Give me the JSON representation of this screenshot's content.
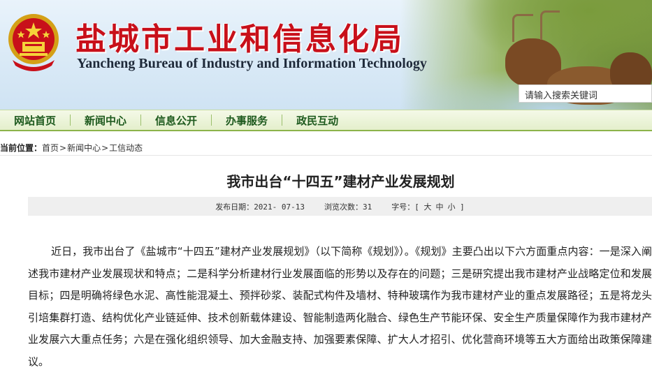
{
  "header": {
    "title_cn": "盐城市工业和信息化局",
    "title_en": "Yancheng Bureau of Industry and Information Technology",
    "search_placeholder": "请输入搜索关键词",
    "emblem_icon": "national-emblem-icon"
  },
  "nav": {
    "items": [
      {
        "label": "网站首页"
      },
      {
        "label": "新闻中心"
      },
      {
        "label": "信息公开"
      },
      {
        "label": "办事服务"
      },
      {
        "label": "政民互动"
      }
    ]
  },
  "breadcrumb": {
    "label": "当前位置：",
    "items": [
      "首页",
      "新闻中心",
      "工信动态"
    ],
    "separator": ">"
  },
  "article": {
    "title": "我市出台“十四五”建材产业发展规划",
    "publish_label": "发布日期：",
    "publish_date": "2021- 07-13",
    "views_label": "浏览次数：",
    "views": "31",
    "font_label": "字号：",
    "font_open": "[",
    "font_large": "大",
    "font_medium": "中",
    "font_small": "小",
    "font_close": "]",
    "body": "近日，我市出台了《盐城市“十四五”建材产业发展规划》（以下简称《规划》）。《规划》主要凸出以下六方面重点内容：一是深入阐述我市建材产业发展现状和特点；二是科学分析建材行业发展面临的形势以及存在的问题；三是研究提出我市建材产业战略定位和发展目标；四是明确将绿色水泥、高性能混凝土、预拌砂浆、装配式构件及墙材、特种玻璃作为我市建材产业的重点发展路径；五是将龙头引培集群打造、结构优化产业链延伸、技术创新载体建设、智能制造两化融合、绿色生产节能环保、安全生产质量保障作为我市建材产业发展六大重点任务；六是在强化组织领导、加大金融支持、加强要素保障、扩大人才招引、优化营商环境等五大方面给出政策保障建议。"
  },
  "colors": {
    "title_red": "#c8101a",
    "nav_green": "#1e5a1e",
    "nav_border": "#8cb34a",
    "meta_bg": "#efefef"
  }
}
